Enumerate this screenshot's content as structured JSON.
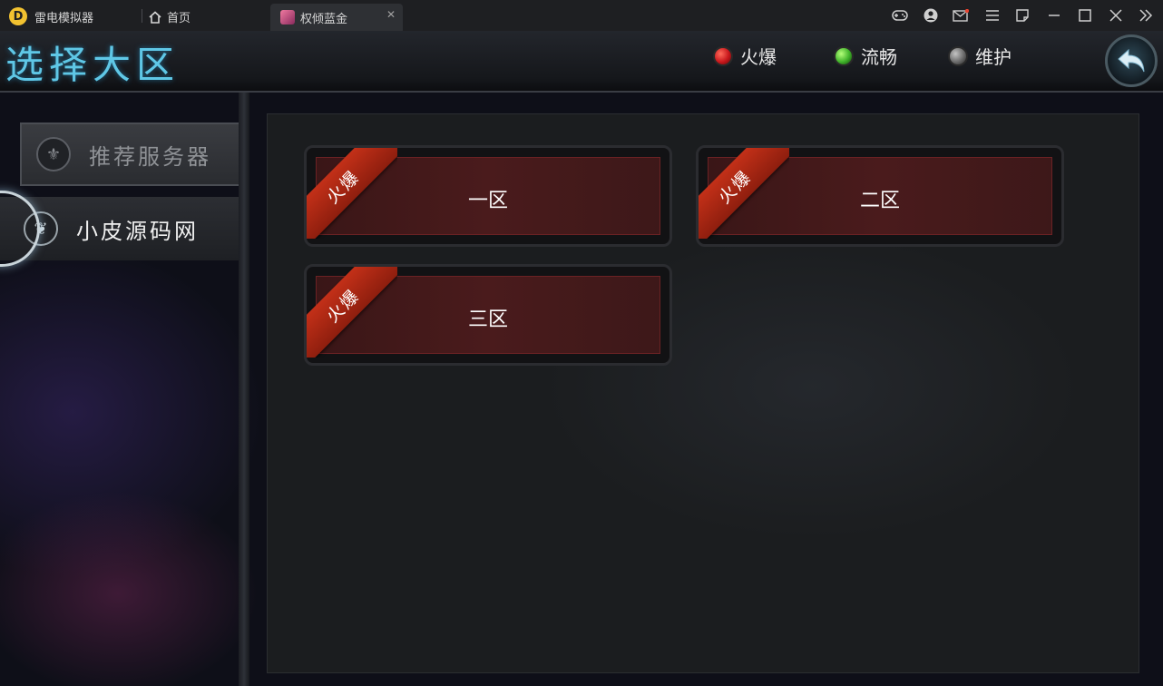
{
  "emulator": {
    "app_name": "雷电模拟器",
    "logo_glyph": "D",
    "home_tab": "首页",
    "game_tab": "权倾蓝金",
    "close_glyph": "✕"
  },
  "game": {
    "title": "选择大区",
    "legend": [
      {
        "label": "火爆",
        "color": "#c8171c"
      },
      {
        "label": "流畅",
        "color": "#3fb22a"
      },
      {
        "label": "维护",
        "color": "#6b6b6b"
      }
    ],
    "sidebar": {
      "recommend_label": "推荐服务器",
      "selected_label": "小皮源码网"
    },
    "servers": [
      {
        "name": "一区",
        "badge": "火爆"
      },
      {
        "name": "二区",
        "badge": "火爆"
      },
      {
        "name": "三区",
        "badge": "火爆"
      }
    ]
  }
}
